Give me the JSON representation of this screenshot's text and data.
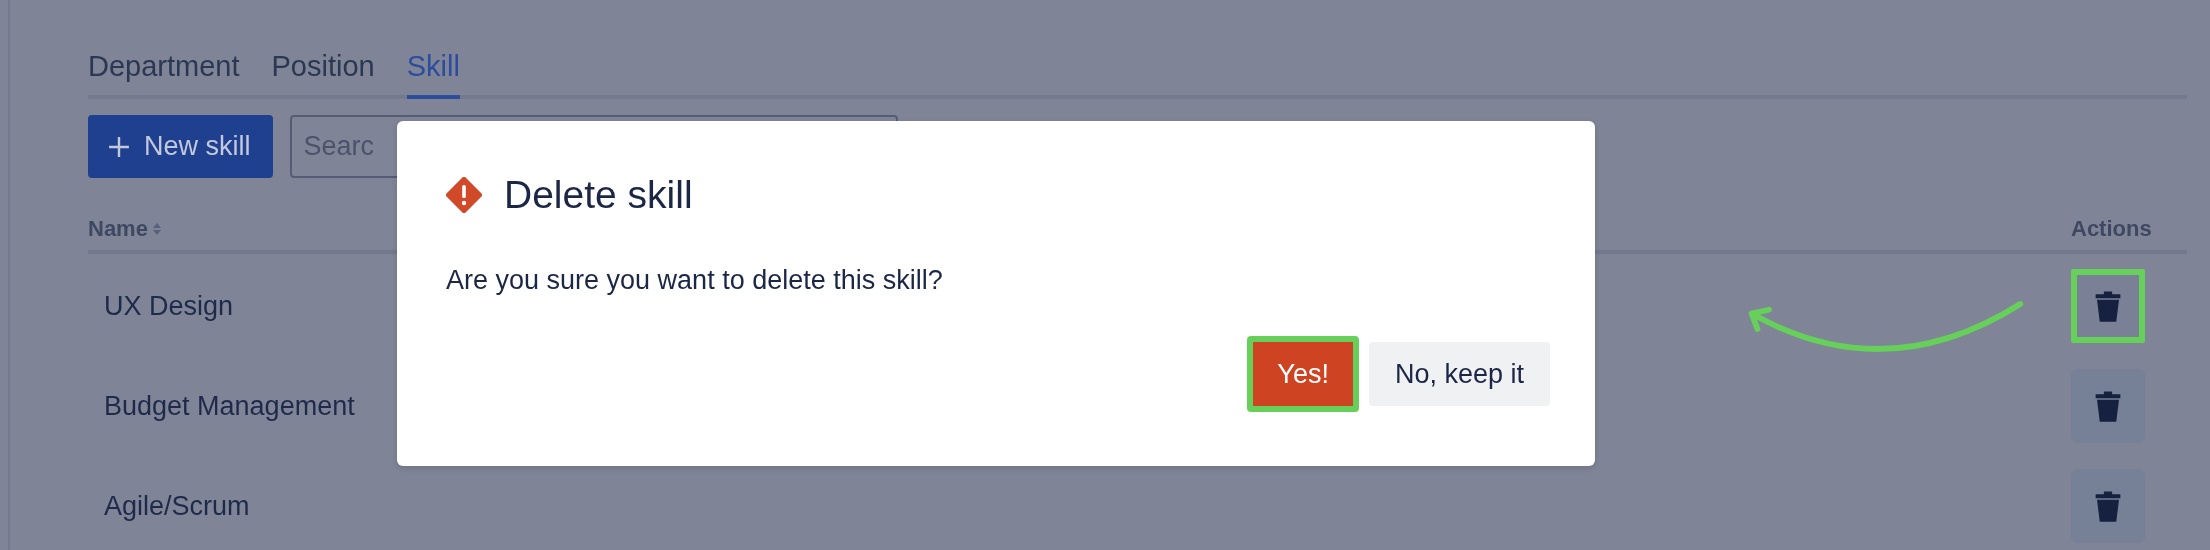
{
  "tabs": [
    {
      "label": "Department",
      "selected": false
    },
    {
      "label": "Position",
      "selected": false
    },
    {
      "label": "Skill",
      "selected": true
    }
  ],
  "toolbar": {
    "new_button": {
      "label": "New skill"
    },
    "search": {
      "placeholder": "Searc"
    }
  },
  "table": {
    "columns": [
      {
        "label": "Name",
        "sortable": true
      },
      {
        "label": "Actions",
        "sortable": false
      }
    ],
    "rows": [
      {
        "name": "UX Design",
        "delete_highlighted": true
      },
      {
        "name": "Budget Management",
        "delete_highlighted": false
      },
      {
        "name": "Agile/Scrum",
        "delete_highlighted": false
      }
    ]
  },
  "dialog": {
    "title": "Delete skill",
    "message": "Are you sure you want to delete this skill?",
    "buttons": [
      {
        "label": "Yes!",
        "kind": "danger",
        "highlighted": true
      },
      {
        "label": "No, keep it",
        "kind": "subtle",
        "highlighted": false
      }
    ]
  }
}
